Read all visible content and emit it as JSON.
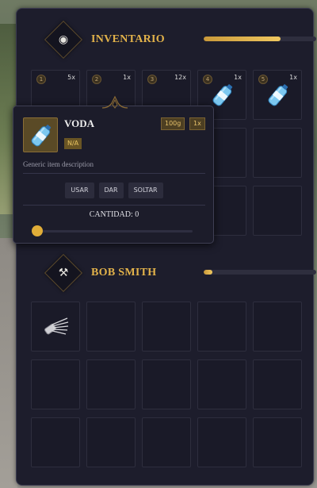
{
  "inventory": {
    "title": "INVENTARIO",
    "icon": "lens-icon",
    "weight_fraction": 0.68,
    "slots": [
      {
        "num": "1",
        "count": "5x",
        "item": ""
      },
      {
        "num": "2",
        "count": "1x",
        "item": ""
      },
      {
        "num": "3",
        "count": "12x",
        "item": ""
      },
      {
        "num": "4",
        "count": "1x",
        "item": "water-bottle"
      },
      {
        "num": "5",
        "count": "1x",
        "item": "water-bottle"
      }
    ]
  },
  "tooltip": {
    "name": "VODA",
    "weight": "100g",
    "quantity": "1x",
    "rarity": "N/A",
    "description": "Generic item description",
    "actions": [
      "USAR",
      "DAR",
      "SOLTAR"
    ],
    "amount_label": "CANTIDAD: 0",
    "amount": 0
  },
  "other": {
    "title": "BOB SMITH",
    "icon": "hammer-pick-icon",
    "weight_fraction": 0.08,
    "first_item": "lockpick-set"
  },
  "colors": {
    "accent": "#e2b24a",
    "panel": "#1d1d2c",
    "slot": "#1a1a28"
  }
}
